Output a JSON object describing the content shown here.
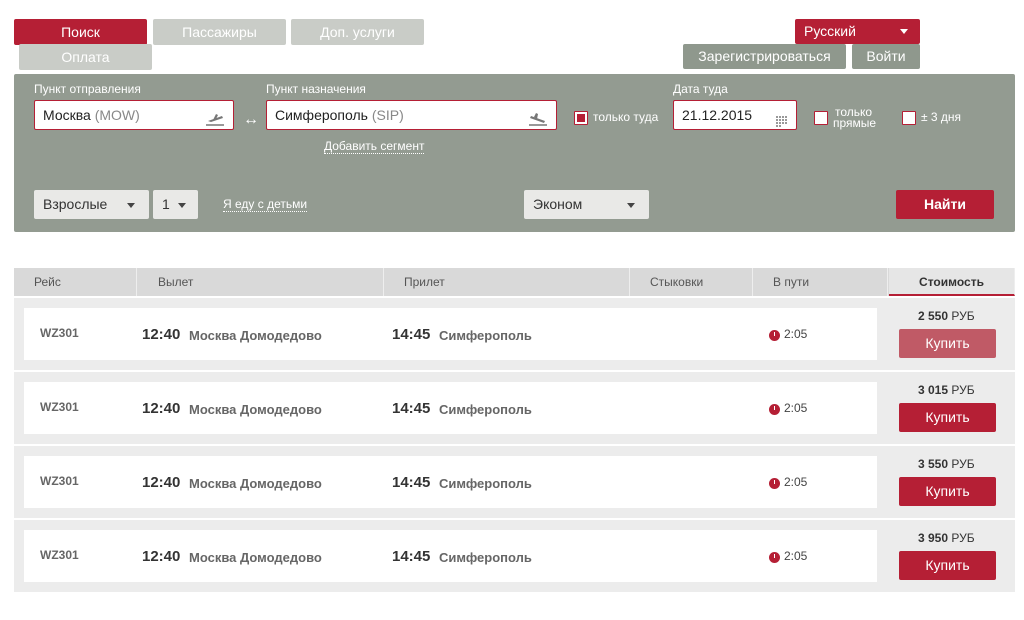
{
  "nav": {
    "search": "Поиск",
    "passengers": "Пассажиры",
    "services": "Доп. услуги",
    "payment": "Оплата",
    "language": "Русский",
    "register": "Зарегистрироваться",
    "login": "Войти"
  },
  "form": {
    "origin_label": "Пункт отправления",
    "origin_city": "Москва",
    "origin_code": "(MOW)",
    "dest_label": "Пункт назначения",
    "dest_city": "Симферополь",
    "dest_code": "(SIP)",
    "one_way": "только туда",
    "date_label": "Дата туда",
    "date": "21.12.2015",
    "direct_line1": "только",
    "direct_line2": "прямые",
    "plus_minus": "± 3 дня",
    "add_segment": "Добавить сегмент",
    "pax_type": "Взрослые",
    "pax_count": "1",
    "with_kids": "Я еду с детьми",
    "cabin": "Эконом",
    "find": "Найти"
  },
  "table": {
    "headers": [
      "Рейс",
      "Вылет",
      "Прилет",
      "Стыковки",
      "В пути",
      "Стоимость"
    ],
    "rows": [
      {
        "flight": "WZ301",
        "dep_time": "12:40",
        "dep_airport": "Москва Домодедово",
        "arr_time": "14:45",
        "arr_airport": "Симферополь",
        "duration": "2:05",
        "price": "2 550",
        "currency": "РУБ",
        "buy": "Купить"
      },
      {
        "flight": "WZ301",
        "dep_time": "12:40",
        "dep_airport": "Москва Домодедово",
        "arr_time": "14:45",
        "arr_airport": "Симферополь",
        "duration": "2:05",
        "price": "3 015",
        "currency": "РУБ",
        "buy": "Купить"
      },
      {
        "flight": "WZ301",
        "dep_time": "12:40",
        "dep_airport": "Москва Домодедово",
        "arr_time": "14:45",
        "arr_airport": "Симферополь",
        "duration": "2:05",
        "price": "3 550",
        "currency": "РУБ",
        "buy": "Купить"
      },
      {
        "flight": "WZ301",
        "dep_time": "12:40",
        "dep_airport": "Москва Домодедово",
        "arr_time": "14:45",
        "arr_airport": "Симферополь",
        "duration": "2:05",
        "price": "3 950",
        "currency": "РУБ",
        "buy": "Купить"
      }
    ]
  },
  "colors": {
    "accent": "#b51f35",
    "panel": "#939b91",
    "tab_inactive": "#c9ccc7"
  }
}
